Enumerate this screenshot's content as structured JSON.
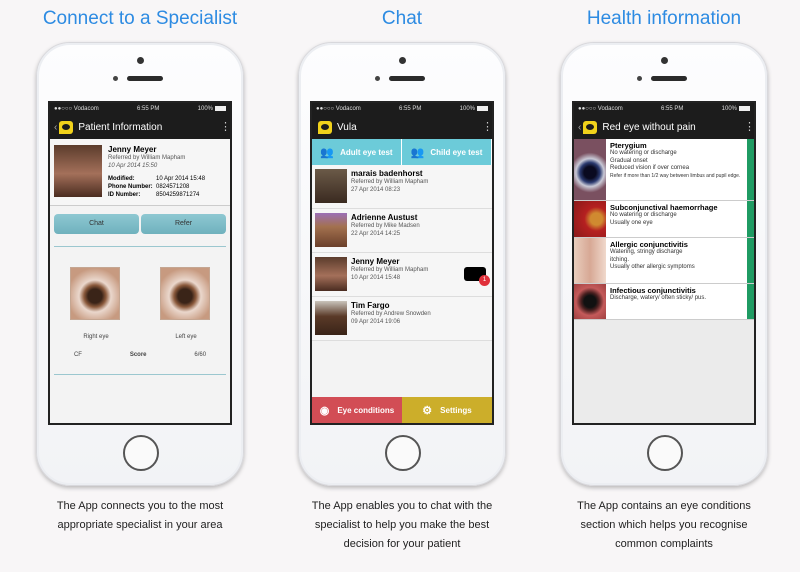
{
  "panels": [
    {
      "heading": "Connect to a Specialist",
      "caption_lines": [
        "The App connects you to the most",
        "appropriate specialist in your area"
      ],
      "status": {
        "carrier": "●●○○○ Vodacom",
        "time": "6:55 PM",
        "battery": "100%"
      },
      "appbar_title": "Patient Information",
      "patient": {
        "name": "Jenny Meyer",
        "referred_by": "Referred by William Mapham",
        "date": "10 Apr 2014 15:50",
        "fields": [
          {
            "label": "Modified:",
            "value": "10 Apr 2014 15:48"
          },
          {
            "label": "Phone Number:",
            "value": "0824571208"
          },
          {
            "label": "ID Number:",
            "value": "8504259871274"
          }
        ]
      },
      "buttons": {
        "chat": "Chat",
        "refer": "Refer"
      },
      "eyes": {
        "right_label": "Right eye",
        "left_label": "Left eye",
        "right_score": "CF",
        "score_label": "Score",
        "left_score": "6/60"
      }
    },
    {
      "heading": "Chat",
      "caption_lines": [
        "The App enables you to chat with the",
        "specialist to help you make the best",
        "decision for your patient"
      ],
      "status": {
        "carrier": "●●○○○ Vodacom",
        "time": "6:55 PM",
        "battery": "100%"
      },
      "appbar_title": "Vula",
      "tabs": [
        "Adult eye test",
        "Child eye test"
      ],
      "patients": [
        {
          "name": "marais badenhorst",
          "referred_by": "Referred by William Mapham",
          "date": "27 Apr 2014 08:23",
          "unread": null
        },
        {
          "name": "Adrienne Austust",
          "referred_by": "Referred by Mike Madsen",
          "date": "22 Apr 2014 14:25",
          "unread": null
        },
        {
          "name": "Jenny Meyer",
          "referred_by": "Referred by William Mapham",
          "date": "10 Apr 2014 15:48",
          "unread": "1"
        },
        {
          "name": "Tim Fargo",
          "referred_by": "Referred by Andrew Snowden",
          "date": "09 Apr 2014 19:06",
          "unread": null
        }
      ],
      "bottom": {
        "eye_conditions": "Eye conditions",
        "settings": "Settings"
      }
    },
    {
      "heading": "Health information",
      "caption_lines": [
        "The App contains an eye conditions",
        "section which helps you recognise",
        "common complaints"
      ],
      "status": {
        "carrier": "●●○○○ Vodacom",
        "time": "6:55 PM",
        "battery": "100%"
      },
      "appbar_title": "Red eye without pain",
      "conditions": [
        {
          "title": "Pterygium",
          "lines": [
            "No watering or discharge",
            "Gradual onset",
            "Reduced vision if over cornea"
          ],
          "note": "Refer if more than 1/2 way between limbus and pupil edge."
        },
        {
          "title": "Subconjunctival haemorrhage",
          "lines": [
            "No watering or discharge",
            "Usually one eye"
          ],
          "note": null
        },
        {
          "title": "Allergic conjunctivitis",
          "lines": [
            "Watering, stringy discharge",
            "itching.",
            "Usually other allergic symptoms"
          ],
          "note": null
        },
        {
          "title": "Infectious conjunctivitis",
          "lines": [
            "Discharge, watery/ often sticky/ pus."
          ],
          "note": null
        }
      ]
    }
  ],
  "colors": {
    "heading": "#2d8be2",
    "tab_blue": "#6ccbd9",
    "eye_conditions_red": "#d24d55",
    "settings_gold": "#ccae2a",
    "condition_green": "#1f9b63",
    "badge_red": "#e0303a",
    "button_teal": "#7fbcc6"
  }
}
